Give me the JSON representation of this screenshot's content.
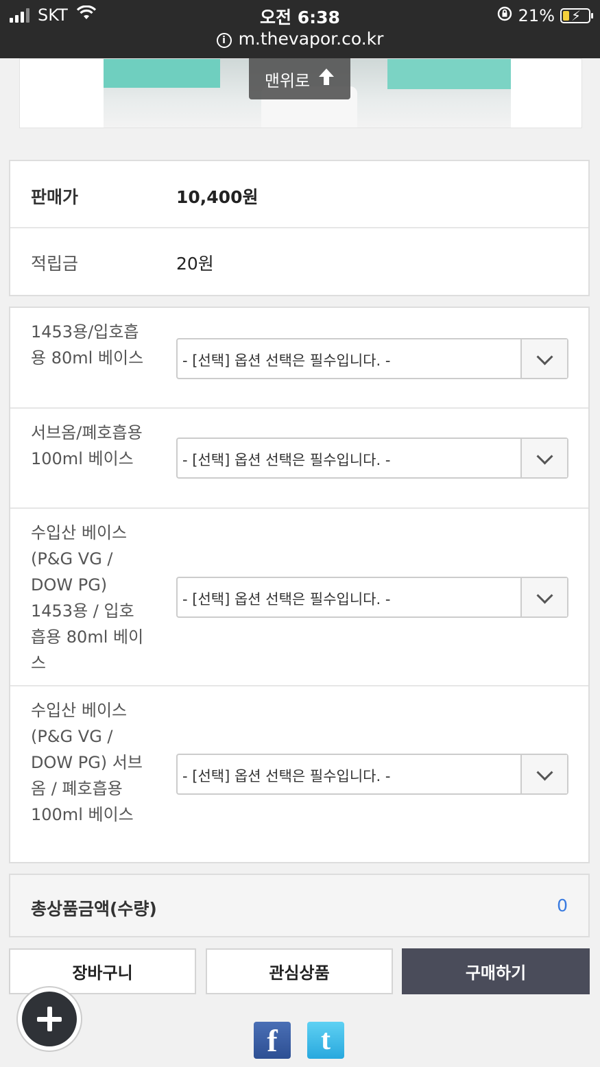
{
  "status_bar": {
    "carrier": "SKT",
    "time": "오전 6:38",
    "battery": "21%",
    "url": "m.thevapor.co.kr"
  },
  "top_button": {
    "label": "맨위로"
  },
  "price_table": {
    "sale_price_label": "판매가",
    "sale_price_value": "10,400원",
    "points_label": "적립금",
    "points_value": "20원"
  },
  "options": [
    {
      "label": "1453용/입호흡용 80ml 베이스",
      "selected": "- [선택] 옵션 선택은 필수입니다. -"
    },
    {
      "label": "서브옴/폐호흡용 100ml 베이스",
      "selected": "- [선택] 옵션 선택은 필수입니다. -"
    },
    {
      "label": "수입산 베이스 (P&G VG / DOW PG) 1453용 / 입호흡용 80ml 베이스",
      "selected": "- [선택] 옵션 선택은 필수입니다. -"
    },
    {
      "label": "수입산 베이스 (P&G VG / DOW PG) 서브옴 / 폐호흡용 100ml 베이스",
      "selected": "- [선택] 옵션 선택은 필수입니다. -"
    }
  ],
  "total": {
    "label": "총상품금액(수량)",
    "value": "0"
  },
  "actions": {
    "cart": "장바구니",
    "wishlist": "관심상품",
    "buy": "구매하기"
  },
  "social": {
    "facebook": "f",
    "twitter": "t"
  },
  "colors": {
    "buy_button": "#4a4c5a",
    "total_value": "#3a7be0",
    "status_bar": "#2b2b2b"
  }
}
